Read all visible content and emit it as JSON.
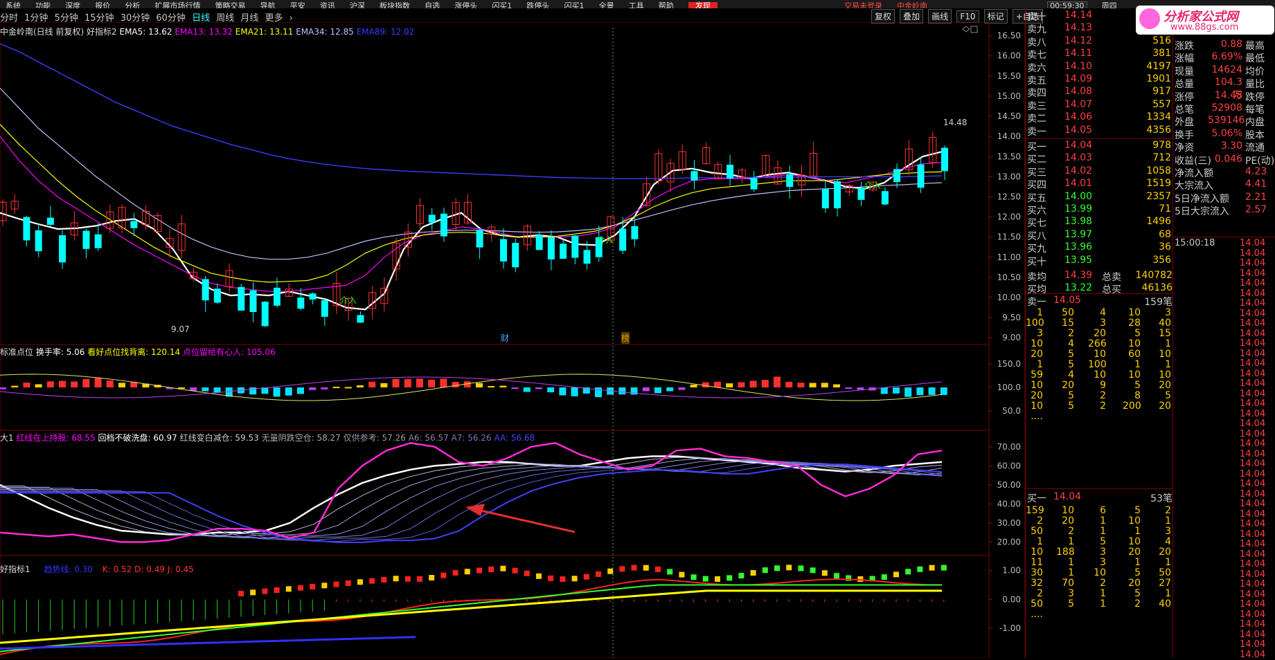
{
  "menu": {
    "items": [
      "系统",
      "功能",
      "深度",
      "报价",
      "分析",
      "扩展市场行情",
      "策略交易",
      "导航",
      "平安",
      "资讯",
      "沪深",
      "板块指数",
      "自选",
      "涨停头",
      "闪买1",
      "跌停头",
      "闪买1",
      "全景",
      "工具",
      "帮助"
    ],
    "highlight": "发现",
    "notice": "交易未登录",
    "notice2": "中金岭南",
    "clock": "00:59:30",
    "weekday": "周四"
  },
  "periods": [
    "分时",
    "1分钟",
    "5分钟",
    "15分钟",
    "30分钟",
    "60分钟",
    "日线",
    "周线",
    "月线",
    "更多"
  ],
  "active_period": "日线",
  "more_arrow": "›",
  "toolbar": [
    "复权",
    "叠加",
    "画线",
    "F10",
    "标记",
    "+自选"
  ],
  "watermark": {
    "title": "分析家公式网",
    "url": "www.88gs.com"
  },
  "main_panel": {
    "stock_label": "中金岭南(日线 前复权)",
    "indicator": "好指标2",
    "ema5": "EMA5: 13.62",
    "ema13": "EMA13: 13.32",
    "ema21": "EMA21: 13.11",
    "ema34": "EMA34: 12.85",
    "ema89": "EMA89: 12.02",
    "high_label": "14.48",
    "low_label": "9.07",
    "entry_label": "介入",
    "marker_cai": "财",
    "marker_sheng": "榜"
  },
  "colors": {
    "up": "#ff3232",
    "down": "#00ffff",
    "ema5": "#ffffff",
    "ema13": "#ff00ff",
    "ema21": "#ffff00",
    "ema34": "#c0c0ff",
    "ema89": "#3c3cff"
  },
  "chart_data": [
    {
      "type": "line",
      "title": "中金岭南 日线",
      "y_axis_ticks": [
        "16.50",
        "16.00",
        "15.50",
        "15.00",
        "14.50",
        "14.00",
        "13.50",
        "13.00",
        "12.50",
        "12.00",
        "11.50",
        "11.00",
        "10.50",
        "10.00",
        "9.50",
        "9.00"
      ],
      "ylim": [
        8.9,
        16.7
      ],
      "annotations": [
        "14.48",
        "9.07"
      ],
      "series": [
        {
          "name": "EMA5",
          "values": [
            12.1,
            11.95,
            11.82,
            11.7,
            11.72,
            11.78,
            11.9,
            11.95,
            11.7,
            11.2,
            10.5,
            10.2,
            10.05,
            10.08,
            10.05,
            10.15,
            10.05,
            9.95,
            9.75,
            9.7,
            10.1,
            11.2,
            11.75,
            11.95,
            12.1,
            11.7,
            11.55,
            11.5,
            11.55,
            11.5,
            11.32,
            11.3,
            11.55,
            12.0,
            12.8,
            13.15,
            13.2,
            13.1,
            13.05,
            12.95,
            13.05,
            13.1,
            13.0,
            12.9,
            12.75,
            12.7,
            12.85,
            13.2,
            13.5,
            13.62
          ]
        },
        {
          "name": "EMA13",
          "values": [
            14.0,
            13.4,
            12.9,
            12.5,
            12.2,
            11.9,
            11.6,
            11.3,
            11.05,
            10.8,
            10.55,
            10.35,
            10.25,
            10.2,
            10.15,
            10.15,
            10.2,
            10.25,
            10.3,
            10.55,
            11.0,
            11.35,
            11.55,
            11.65,
            11.75,
            11.7,
            11.6,
            11.5,
            11.5,
            11.5,
            11.52,
            11.6,
            11.75,
            12.1,
            12.45,
            12.7,
            12.9,
            12.95,
            12.95,
            12.95,
            13.0,
            13.05,
            13.0,
            12.9,
            12.85,
            12.95,
            13.05,
            13.2,
            13.32,
            13.35
          ]
        },
        {
          "name": "EMA21",
          "values": [
            14.3,
            13.8,
            13.35,
            12.9,
            12.5,
            12.15,
            11.85,
            11.55,
            11.25,
            11.0,
            10.8,
            10.6,
            10.5,
            10.42,
            10.38,
            10.4,
            10.42,
            10.55,
            10.8,
            11.1,
            11.3,
            11.45,
            11.55,
            11.6,
            11.62,
            11.6,
            11.55,
            11.5,
            11.5,
            11.52,
            11.58,
            11.65,
            11.8,
            12.0,
            12.25,
            12.45,
            12.6,
            12.7,
            12.75,
            12.8,
            12.85,
            12.9,
            12.9,
            12.9,
            12.95,
            13.0,
            13.05,
            13.08,
            13.11,
            13.12
          ]
        },
        {
          "name": "EMA34",
          "values": [
            15.2,
            14.7,
            14.2,
            13.8,
            13.4,
            13.0,
            12.65,
            12.3,
            12.0,
            11.7,
            11.45,
            11.25,
            11.1,
            11.0,
            10.95,
            10.95,
            11.0,
            11.1,
            11.25,
            11.4,
            11.5,
            11.57,
            11.62,
            11.65,
            11.67,
            11.67,
            11.65,
            11.63,
            11.62,
            11.63,
            11.66,
            11.7,
            11.8,
            11.92,
            12.05,
            12.18,
            12.3,
            12.4,
            12.48,
            12.55,
            12.6,
            12.65,
            12.68,
            12.7,
            12.72,
            12.75,
            12.78,
            12.8,
            12.83,
            12.85
          ]
        },
        {
          "name": "EMA89",
          "values": [
            16.3,
            16.1,
            15.85,
            15.6,
            15.35,
            15.1,
            14.85,
            14.65,
            14.45,
            14.25,
            14.1,
            13.95,
            13.8,
            13.68,
            13.55,
            13.45,
            13.37,
            13.3,
            13.25,
            13.2,
            13.17,
            13.14,
            13.12,
            13.1,
            13.08,
            13.06,
            13.04,
            13.02,
            13.0,
            12.98,
            12.97,
            12.96,
            12.95,
            12.95,
            12.95,
            12.96,
            12.97,
            12.97,
            12.97,
            12.98,
            12.98,
            12.99,
            12.99,
            13.0,
            13.0,
            13.0,
            13.0,
            13.0,
            13.01,
            13.02
          ]
        }
      ]
    },
    {
      "type": "bar",
      "title": "标准点位",
      "y_axis_ticks": [
        "150.0",
        "100.0",
        "50.0"
      ],
      "ylim": [
        15,
        185
      ]
    },
    {
      "type": "line",
      "title": "大1",
      "y_axis_ticks": [
        "70.00",
        "60.00",
        "50.00",
        "40.00",
        "30.00",
        "20.00"
      ],
      "ylim": [
        14,
        75
      ]
    },
    {
      "type": "bar",
      "title": "好指标1",
      "y_axis_ticks": [
        "1.00",
        "0.00",
        "-1.00"
      ],
      "ylim": [
        -1.95,
        1.3
      ]
    }
  ],
  "indicator_panel_1": {
    "name": "标准点位",
    "label1": "换手率: 5.06",
    "label2": "看好点位找背离: 120.14",
    "label3": "点位留给有心人: 105.06"
  },
  "indicator_panel_2": {
    "name": "大1",
    "label1": "红线在上持股: 68.55",
    "label2": "回档不破洗盘: 60.97",
    "label3": "红线变白减仓: 59.53",
    "label4": "无量阴跌空仓: 58.27",
    "label5": "仅供参考: 57.26",
    "label6": "A6: 56.57",
    "label7": "A7: 56.26",
    "label8": "AA: 56.68"
  },
  "indicator_panel_3": {
    "name": "好指标1",
    "label1": "趋势线: 0.30",
    "label2": "K: 0.52",
    "label3": "D: 0.49",
    "label4": "J: 0.45"
  },
  "order_book": {
    "asks": [
      {
        "label": "卖十",
        "price": "14.14",
        "vol": ""
      },
      {
        "label": "卖九",
        "price": "14.13",
        "vol": ""
      },
      {
        "label": "卖八",
        "price": "14.12",
        "vol": "516"
      },
      {
        "label": "卖七",
        "price": "14.11",
        "vol": "381"
      },
      {
        "label": "卖六",
        "price": "14.10",
        "vol": "4197"
      },
      {
        "label": "卖五",
        "price": "14.09",
        "vol": "1901"
      },
      {
        "label": "卖四",
        "price": "14.08",
        "vol": "917"
      },
      {
        "label": "卖三",
        "price": "14.07",
        "vol": "557"
      },
      {
        "label": "卖二",
        "price": "14.06",
        "vol": "1334"
      },
      {
        "label": "卖一",
        "price": "14.05",
        "vol": "4356"
      }
    ],
    "bids": [
      {
        "label": "买一",
        "price": "14.04",
        "vol": "978"
      },
      {
        "label": "买二",
        "price": "14.03",
        "vol": "712"
      },
      {
        "label": "买三",
        "price": "14.02",
        "vol": "1058"
      },
      {
        "label": "买四",
        "price": "14.01",
        "vol": "1519"
      },
      {
        "label": "买五",
        "price": "14.00",
        "vol": "2357"
      },
      {
        "label": "买六",
        "price": "13.99",
        "vol": "71"
      },
      {
        "label": "买七",
        "price": "13.98",
        "vol": "1496"
      },
      {
        "label": "买八",
        "price": "13.97",
        "vol": "68"
      },
      {
        "label": "买九",
        "price": "13.96",
        "vol": "36"
      },
      {
        "label": "买十",
        "price": "13.95",
        "vol": "356"
      }
    ],
    "avg_ask_label": "卖均",
    "avg_ask": "14.39",
    "total_ask_label": "总卖",
    "total_ask": "140782",
    "avg_bid_label": "买均",
    "avg_bid": "13.22",
    "total_bid_label": "总买",
    "total_bid": "46136",
    "queue_ask_label": "卖一",
    "queue_ask_price": "14.05",
    "queue_ask_count": "159笔",
    "queue_bid_label": "买一",
    "queue_bid_price": "14.04",
    "queue_bid_count": "53笔",
    "ask_queue": [
      [
        "1",
        "50",
        "4",
        "10",
        "3"
      ],
      [
        "100",
        "15",
        "3",
        "28",
        "40"
      ],
      [
        "3",
        "2",
        "20",
        "5",
        "15"
      ],
      [
        "10",
        "4",
        "266",
        "10",
        "1"
      ],
      [
        "20",
        "5",
        "10",
        "60",
        "10"
      ],
      [
        "1",
        "5",
        "100",
        "1",
        "1"
      ],
      [
        "59",
        "4",
        "10",
        "10",
        "10"
      ],
      [
        "10",
        "20",
        "9",
        "5",
        "20"
      ],
      [
        "20",
        "5",
        "2",
        "8",
        "5"
      ],
      [
        "10",
        "5",
        "2",
        "200",
        "20"
      ],
      [
        "....",
        "",
        "",
        "",
        ""
      ]
    ],
    "bid_queue": [
      [
        "159",
        "10",
        "6",
        "5",
        "2"
      ],
      [
        "2",
        "20",
        "1",
        "10",
        "1"
      ],
      [
        "50",
        "2",
        "1",
        "1",
        "3"
      ],
      [
        "1",
        "1",
        "5",
        "10",
        "4"
      ],
      [
        "10",
        "188",
        "3",
        "20",
        "20"
      ],
      [
        "11",
        "1",
        "3",
        "1",
        "1"
      ],
      [
        "30",
        "1",
        "10",
        "5",
        "50"
      ],
      [
        "32",
        "70",
        "2",
        "20",
        "27"
      ],
      [
        "2",
        "3",
        "1",
        "5",
        "1"
      ],
      [
        "50",
        "5",
        "1",
        "2",
        "40"
      ],
      [
        "....",
        "",
        "",
        "",
        ""
      ]
    ]
  },
  "quote": {
    "rows": [
      {
        "l1": "涨跌",
        "v1": "0.88",
        "l2": "最高"
      },
      {
        "l1": "涨幅",
        "v1": "6.69%",
        "l2": "最低"
      },
      {
        "l1": "现量",
        "v1": "14624",
        "l2": "均价"
      },
      {
        "l1": "总量",
        "v1": "104.3万",
        "l2": "量比"
      },
      {
        "l1": "涨停",
        "v1": "14.48",
        "l2": "跌停"
      },
      {
        "l1": "总笔",
        "v1": "52908",
        "l2": "每笔"
      },
      {
        "l1": "外盘",
        "v1": "539146",
        "l2": "内盘"
      },
      {
        "l1": "换手",
        "v1": "5.06%",
        "l2": "股本"
      },
      {
        "l1": "净资",
        "v1": "3.30",
        "l2": "流通"
      },
      {
        "l1": "收益(三)",
        "v1": "0.046",
        "l2": "PE(动)"
      },
      {
        "l1": "净流入额",
        "v1": "",
        "l2": "4.23"
      },
      {
        "l1": "大宗流入",
        "v1": "",
        "l2": "4.41"
      },
      {
        "l1": "5日净流入额",
        "v1": "",
        "l2": "2.21"
      },
      {
        "l1": "5日大宗流入",
        "v1": "",
        "l2": "2.57"
      }
    ]
  },
  "ticks": {
    "time": "15:00:18",
    "price": "14.04",
    "count": 42
  }
}
